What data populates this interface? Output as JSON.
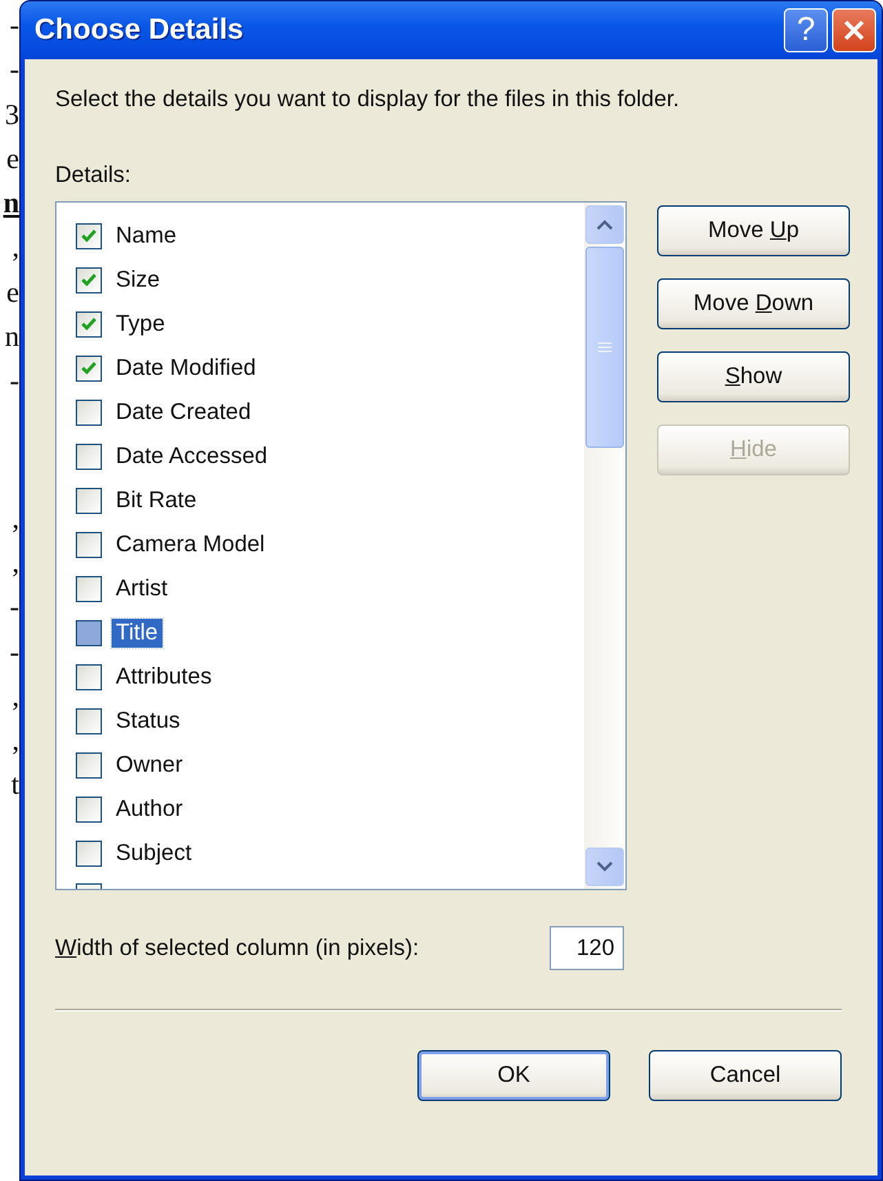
{
  "background_page": {
    "upper_fragments": [
      {
        "text": "-",
        "bold": false
      },
      {
        "text": "-",
        "bold": false
      },
      {
        "text": "3",
        "bold": false
      },
      {
        "text": "e",
        "bold": false
      },
      {
        "text": "n",
        "bold": true
      },
      {
        "text": ",",
        "bold": false
      },
      {
        "text": "e",
        "bold": false
      },
      {
        "text": "n",
        "bold": false
      },
      {
        "text": "-",
        "bold": false
      }
    ],
    "lower_fragments": [
      {
        "text": ",",
        "bold": false
      },
      {
        "text": ",",
        "bold": false
      },
      {
        "text": "-",
        "bold": false
      },
      {
        "text": "-",
        "bold": false
      },
      {
        "text": ",",
        "bold": false
      },
      {
        "text": ",",
        "bold": false
      },
      {
        "text": "t",
        "bold": false
      }
    ]
  },
  "window": {
    "title": "Choose Details",
    "title_buttons": [
      {
        "kind": "help",
        "label": "?"
      },
      {
        "kind": "close"
      }
    ]
  },
  "description": "Select the details you want to display for the files in this folder.",
  "details_label": "Details:",
  "details": [
    {
      "label": "Name",
      "checked": true,
      "selected": false
    },
    {
      "label": "Size",
      "checked": true,
      "selected": false
    },
    {
      "label": "Type",
      "checked": true,
      "selected": false
    },
    {
      "label": "Date Modified",
      "checked": true,
      "selected": false
    },
    {
      "label": "Date Created",
      "checked": false,
      "selected": false
    },
    {
      "label": "Date Accessed",
      "checked": false,
      "selected": false
    },
    {
      "label": "Bit Rate",
      "checked": false,
      "selected": false
    },
    {
      "label": "Camera Model",
      "checked": false,
      "selected": false
    },
    {
      "label": "Artist",
      "checked": false,
      "selected": false
    },
    {
      "label": "Title",
      "checked": false,
      "selected": true
    },
    {
      "label": "Attributes",
      "checked": false,
      "selected": false
    },
    {
      "label": "Status",
      "checked": false,
      "selected": false
    },
    {
      "label": "Owner",
      "checked": false,
      "selected": false
    },
    {
      "label": "Author",
      "checked": false,
      "selected": false
    },
    {
      "label": "Subject",
      "checked": false,
      "selected": false
    }
  ],
  "side_buttons": [
    {
      "before": "Move ",
      "key": "U",
      "after": "p",
      "disabled": false
    },
    {
      "before": "Move ",
      "key": "D",
      "after": "own",
      "disabled": false
    },
    {
      "key": "S",
      "after": "how",
      "disabled": false
    },
    {
      "key": "H",
      "after": "ide",
      "disabled": true
    }
  ],
  "width_field": {
    "label": {
      "key": "W",
      "after": "idth of selected column (in pixels):"
    },
    "value": "120"
  },
  "footer_buttons": [
    {
      "label": "OK",
      "default": true
    },
    {
      "label": "Cancel",
      "default": false
    }
  ]
}
